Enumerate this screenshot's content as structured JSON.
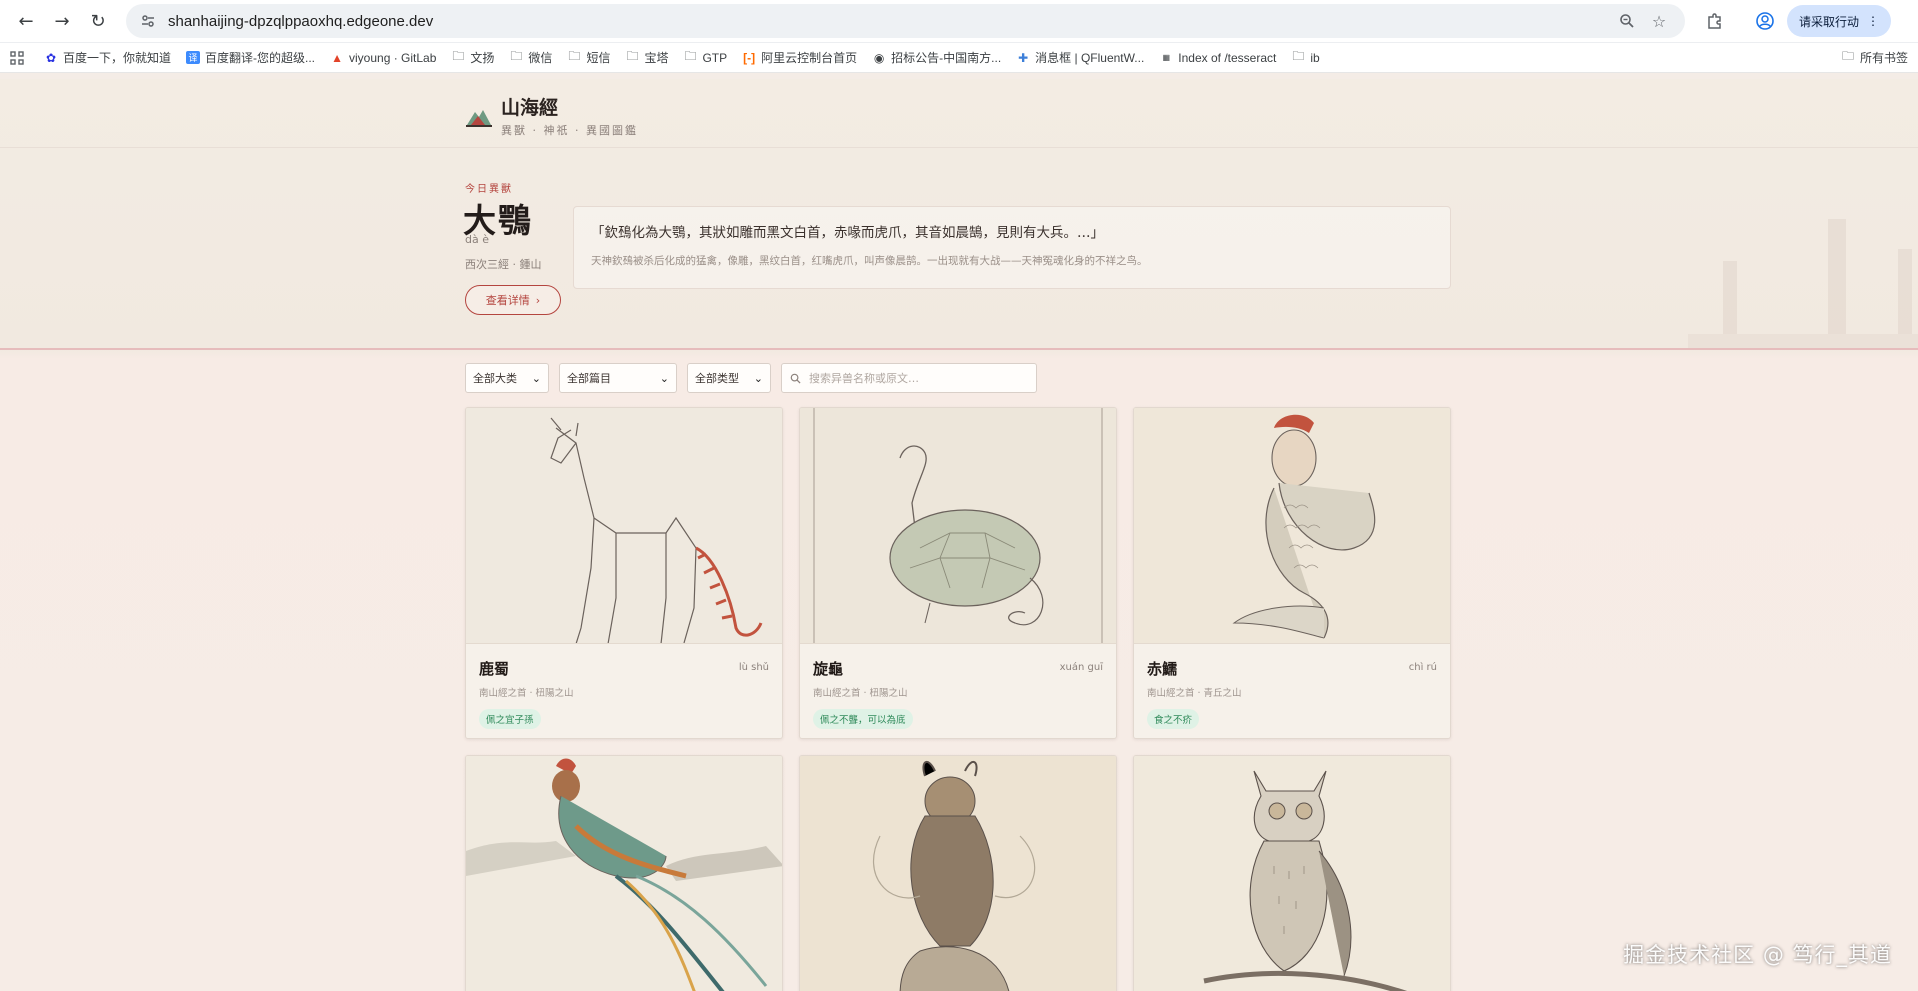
{
  "browser": {
    "url": "shanhaijing-dpzqlppaoxhq.edgeone.dev",
    "action_label": "请采取行动",
    "bookmarks": [
      "百度一下，你就知道",
      "百度翻译-您的超级...",
      "viyoung · GitLab",
      "文扬",
      "微信",
      "短信",
      "宝塔",
      "GTP",
      "阿里云控制台首页",
      "招标公告-中国南方...",
      "消息框 | QFluentW...",
      "Index of /tesseract",
      "ib"
    ],
    "all_bookmarks": "所有书签"
  },
  "site": {
    "title": "山海經",
    "subtitle": "異獸 · 神祇 · 異國圖鑑"
  },
  "hero": {
    "label": "今日異獸",
    "name": "大鶚",
    "pinyin": "dà è",
    "source": "西次三經 · 鍾山",
    "button_label": "查看详情",
    "quote": "「欽䲹化為大鶚，其狀如雕而黑文白首，赤喙而虎爪，其音如晨鵠，見則有大兵。…」",
    "translation": "天神欽䲹被杀后化成的猛禽，像雕，黑纹白首，红嘴虎爪，叫声像晨鹄。一出现就有大战——天神冤魂化身的不祥之鸟。"
  },
  "filters": {
    "category": "全部大类",
    "chapter": "全部篇目",
    "type": "全部类型",
    "search_placeholder": "搜索异兽名称或原文…"
  },
  "cards": [
    {
      "name": "鹿蜀",
      "pinyin": "lù shǔ",
      "source": "南山經之首 · 杻陽之山",
      "tag": "佩之宜子孫"
    },
    {
      "name": "旋龜",
      "pinyin": "xuán guī",
      "source": "南山經之首 · 杻陽之山",
      "tag": "佩之不聾，可以為底"
    },
    {
      "name": "赤鱬",
      "pinyin": "chì rú",
      "source": "南山經之首 · 青丘之山",
      "tag": "食之不疥"
    },
    {
      "name": "",
      "pinyin": "",
      "source": "",
      "tag": ""
    },
    {
      "name": "",
      "pinyin": "",
      "source": "",
      "tag": ""
    },
    {
      "name": "",
      "pinyin": "",
      "source": "",
      "tag": ""
    }
  ],
  "watermark": "掘金技术社区 @ 笃行_其道",
  "colors": {
    "accent": "#b4453f",
    "tag_bg": "#dff2e6",
    "tag_text": "#2f8a5a",
    "action_pill": "#d3e3fd"
  }
}
